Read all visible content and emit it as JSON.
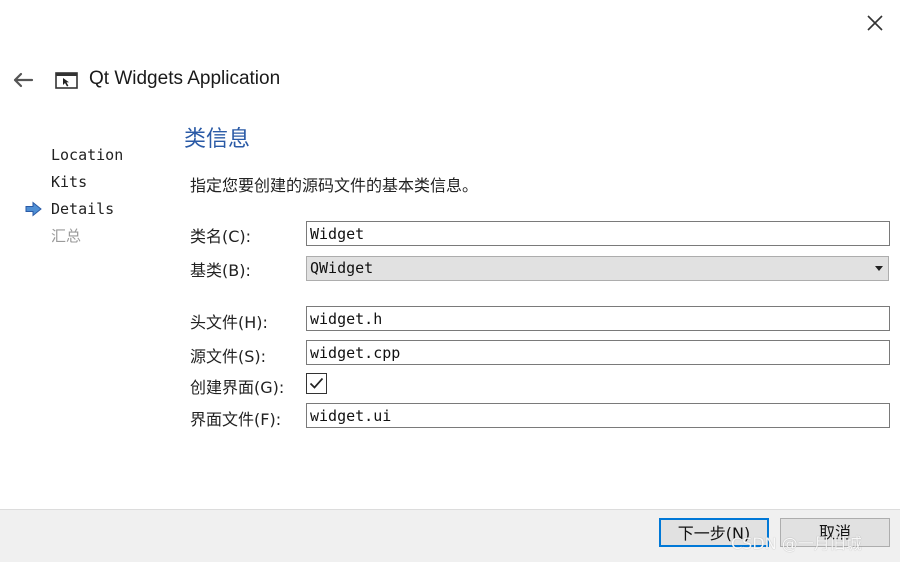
{
  "window": {
    "title": "Qt Widgets Application"
  },
  "steps": [
    {
      "label": "Location",
      "current": false,
      "disabled": false
    },
    {
      "label": "Kits",
      "current": false,
      "disabled": false
    },
    {
      "label": "Details",
      "current": true,
      "disabled": false
    },
    {
      "label": "汇总",
      "current": false,
      "disabled": true
    }
  ],
  "page": {
    "title": "类信息",
    "description": "指定您要创建的源码文件的基本类信息。"
  },
  "form": {
    "class_name": {
      "label": "类名(C):",
      "value": "Widget"
    },
    "base_class": {
      "label": "基类(B):",
      "value": "QWidget"
    },
    "header_file": {
      "label": "头文件(H):",
      "value": "widget.h"
    },
    "source_file": {
      "label": "源文件(S):",
      "value": "widget.cpp"
    },
    "generate_form": {
      "label": "创建界面(G):",
      "checked": true
    },
    "form_file": {
      "label": "界面文件(F):",
      "value": "widget.ui"
    }
  },
  "buttons": {
    "next": "下一步(N)",
    "cancel": "取消"
  },
  "watermark": "CSDN @一月旧城",
  "colors": {
    "accent": "#2a5aa6",
    "focus_border": "#0078d7",
    "footer_bg": "#f0f0f0"
  },
  "icons": {
    "close": "close-icon",
    "back": "back-arrow-icon",
    "app": "qt-widgets-app-icon",
    "current_step": "current-step-arrow-icon",
    "combo": "chevron-down-icon",
    "check": "checkmark-icon"
  }
}
